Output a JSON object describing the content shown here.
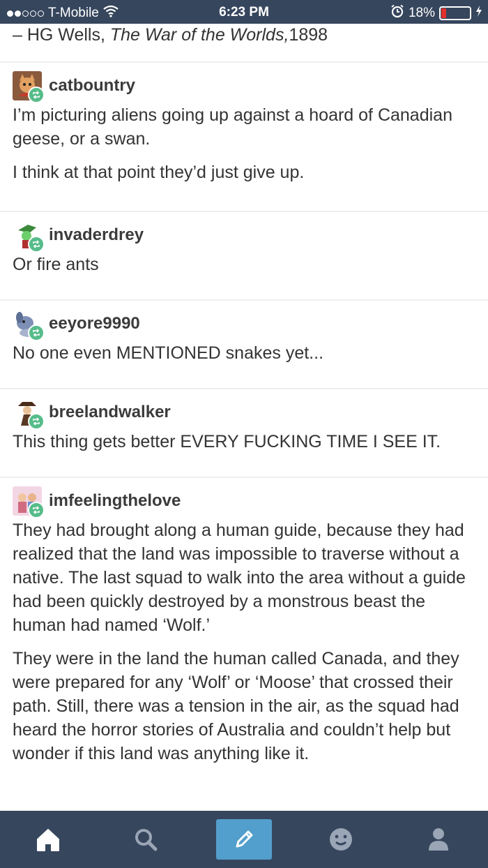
{
  "status_bar": {
    "carrier": "T-Mobile",
    "time": "6:23 PM",
    "battery_percent": "18%",
    "battery_level": 0.18,
    "signal_bars_filled": 2,
    "signal_bars_total": 5,
    "icons": [
      "wifi-icon",
      "alarm-icon",
      "battery-icon",
      "charging-icon"
    ]
  },
  "quote": {
    "prefix": "– HG Wells, ",
    "title": "The War of the Worlds,",
    "year": "1898"
  },
  "posts": [
    {
      "username": "catbountry",
      "paragraphs": [
        "I’m picturing aliens going up against a hoard of Canadian geese, or a swan.",
        "I think at that point they’d just give up."
      ]
    },
    {
      "username": "invaderdrey",
      "paragraphs": [
        "Or fire ants"
      ]
    },
    {
      "username": "eeyore9990",
      "paragraphs": [
        "No one even MENTIONED snakes yet..."
      ]
    },
    {
      "username": "breelandwalker",
      "paragraphs": [
        "This thing gets better EVERY FUCKING TIME I SEE IT."
      ]
    },
    {
      "username": "imfeelingthelove",
      "paragraphs": [
        "They had brought along a human guide, because they had realized that the land was impossible to traverse without a native. The last squad to walk into the area without a guide had been quickly destroyed by a monstrous beast the human had named ‘Wolf.’",
        "They were in the land the human called Canada, and they were prepared for any ‘Wolf’ or ‘Moose’ that crossed their path. Still, there was a tension in the air, as the squad had heard the horror stories of Australia and couldn’t help but wonder if this land was anything like it."
      ]
    }
  ],
  "tab_bar": {
    "tabs": [
      "home-icon",
      "search-icon",
      "compose-icon",
      "activity-icon",
      "account-icon"
    ],
    "active": "home-icon"
  },
  "colors": {
    "bar": "#36465d",
    "compose": "#529ecc",
    "reblog_badge": "#56bc8a",
    "battery_low": "#e0312c"
  }
}
